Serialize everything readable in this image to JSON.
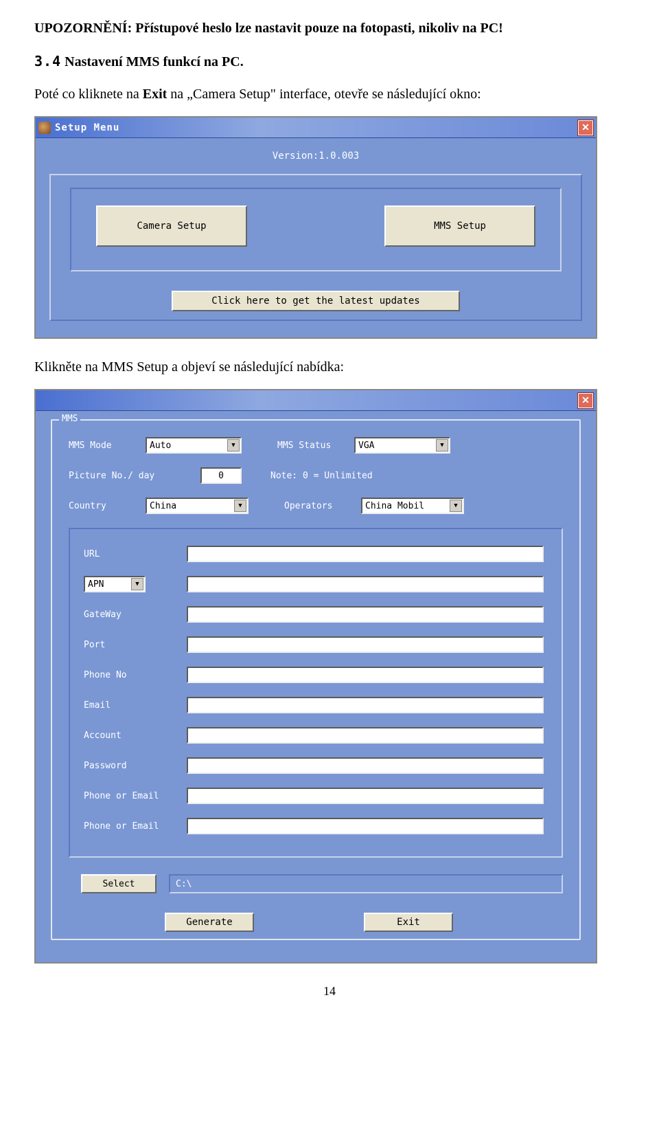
{
  "doc": {
    "warning": "UPOZORNĚNÍ: Přístupové heslo lze nastavit pouze na fotopasti, nikoliv na PC!",
    "section_num": "3.4",
    "section_title": "Nastavení MMS funkcí na PC.",
    "para1_pre": "Poté co kliknete na ",
    "para1_bold": "Exit",
    "para1_post": " na „Camera Setup\" interface, otevře se následující okno:",
    "para2": "Klikněte na MMS Setup a objeví se následující nabídka:",
    "page_number": "14"
  },
  "setup_menu": {
    "title": "Setup Menu",
    "version": "Version:1.0.003",
    "camera_setup_btn": "Camera Setup",
    "mms_setup_btn": "MMS Setup",
    "updates_btn": "Click here to get the latest updates"
  },
  "mms_window": {
    "fieldset_label": "MMS",
    "mms_mode_label": "MMS Mode",
    "mms_mode_value": "Auto",
    "mms_status_label": "MMS Status",
    "mms_status_value": "VGA",
    "pic_no_label": "Picture No./ day",
    "pic_no_value": "0",
    "note_text": "Note: 0 = Unlimited",
    "country_label": "Country",
    "country_value": "China",
    "operators_label": "Operators",
    "operators_value": "China Mobil",
    "fields": {
      "url": "URL",
      "apn": "APN",
      "gateway": "GateWay",
      "port": "Port",
      "phone_no": "Phone No",
      "email": "Email",
      "account": "Account",
      "password": "Password",
      "phone_or_email_1": "Phone or Email",
      "phone_or_email_2": "Phone or Email"
    },
    "select_btn": "Select",
    "path_value": "C:\\",
    "generate_btn": "Generate",
    "exit_btn": "Exit"
  }
}
